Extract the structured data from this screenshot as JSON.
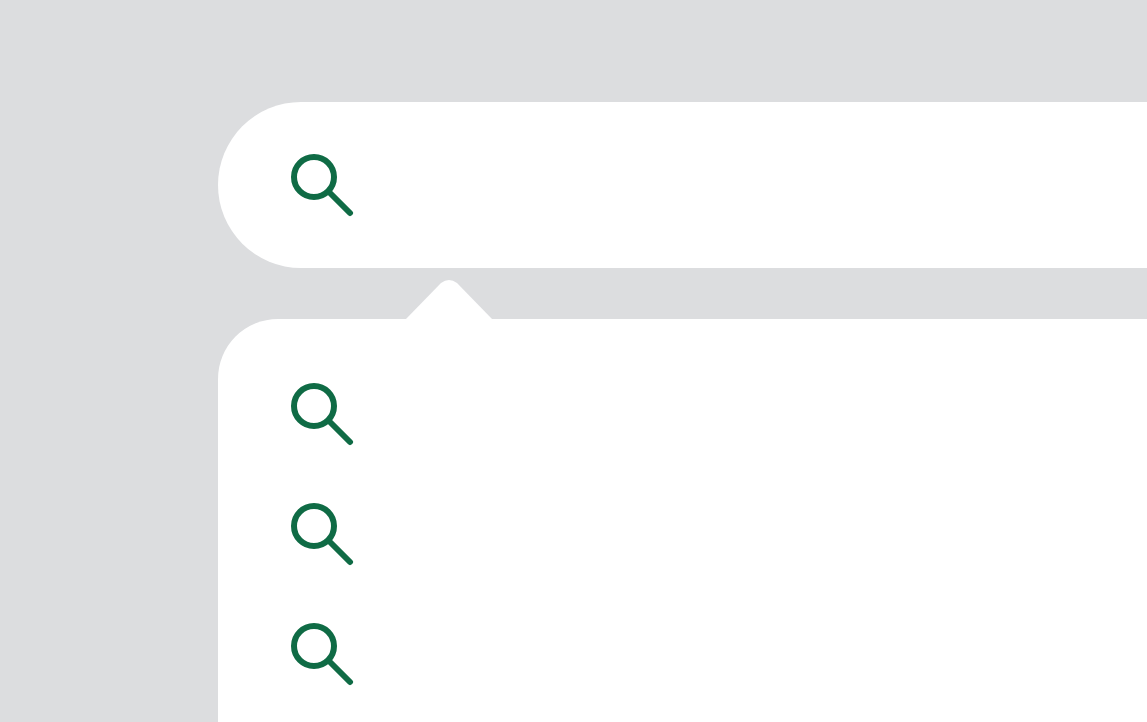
{
  "search_field": {
    "kind": "search"
  },
  "suggestions": [
    {
      "kind": "search"
    },
    {
      "kind": "search"
    },
    {
      "kind": "search"
    }
  ]
}
